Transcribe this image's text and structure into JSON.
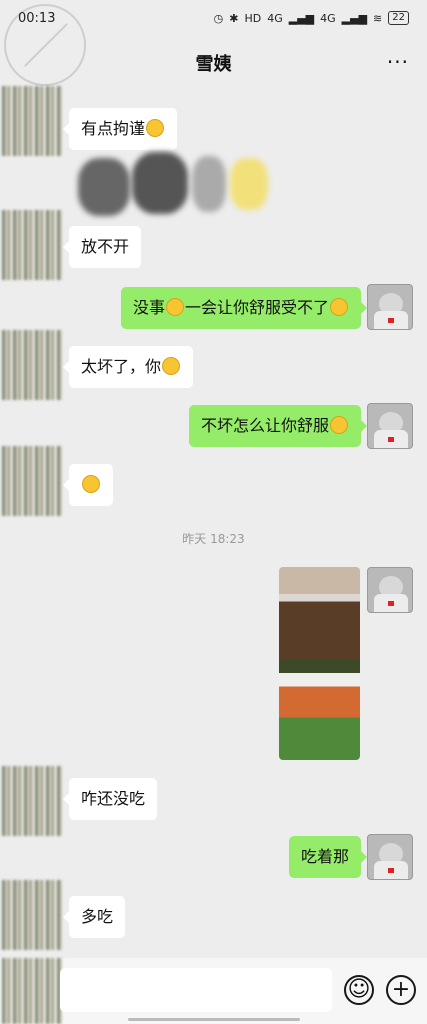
{
  "status_bar": {
    "time": "00:13",
    "network_1": "4G",
    "network_2": "4G",
    "hd_badge": "HD",
    "battery": "22"
  },
  "header": {
    "title": "雪姨",
    "more_label": "···"
  },
  "messages": [
    {
      "side": "in",
      "text": "有点拘谨",
      "emoji": "laugh-cry-emoji"
    },
    {
      "side": "in",
      "text": "放不开"
    },
    {
      "side": "out",
      "text_before": "没事",
      "text_after": "一会让你舒服受不了",
      "emoji_1": "grin-emoji",
      "emoji_2": "thinking-emoji"
    },
    {
      "side": "in",
      "text": "太坏了，你",
      "emoji": "laugh-cry-emoji"
    },
    {
      "side": "out",
      "text": "不坏怎么让你舒服",
      "emoji": "smile-emoji"
    },
    {
      "side": "in",
      "emoji": "laugh-cry-emoji"
    },
    {
      "side": "out",
      "type": "image"
    },
    {
      "side": "in",
      "text": "咋还没吃"
    },
    {
      "side": "out",
      "text": "吃着那"
    },
    {
      "side": "in",
      "text": "多吃"
    }
  ],
  "timestamp": "昨天 18:23",
  "input_bar": {
    "placeholder": "",
    "emoji_button": "☺",
    "plus_button": "+"
  },
  "colors": {
    "background": "#ededed",
    "incoming_bubble": "#ffffff",
    "outgoing_bubble": "#95ec69"
  }
}
